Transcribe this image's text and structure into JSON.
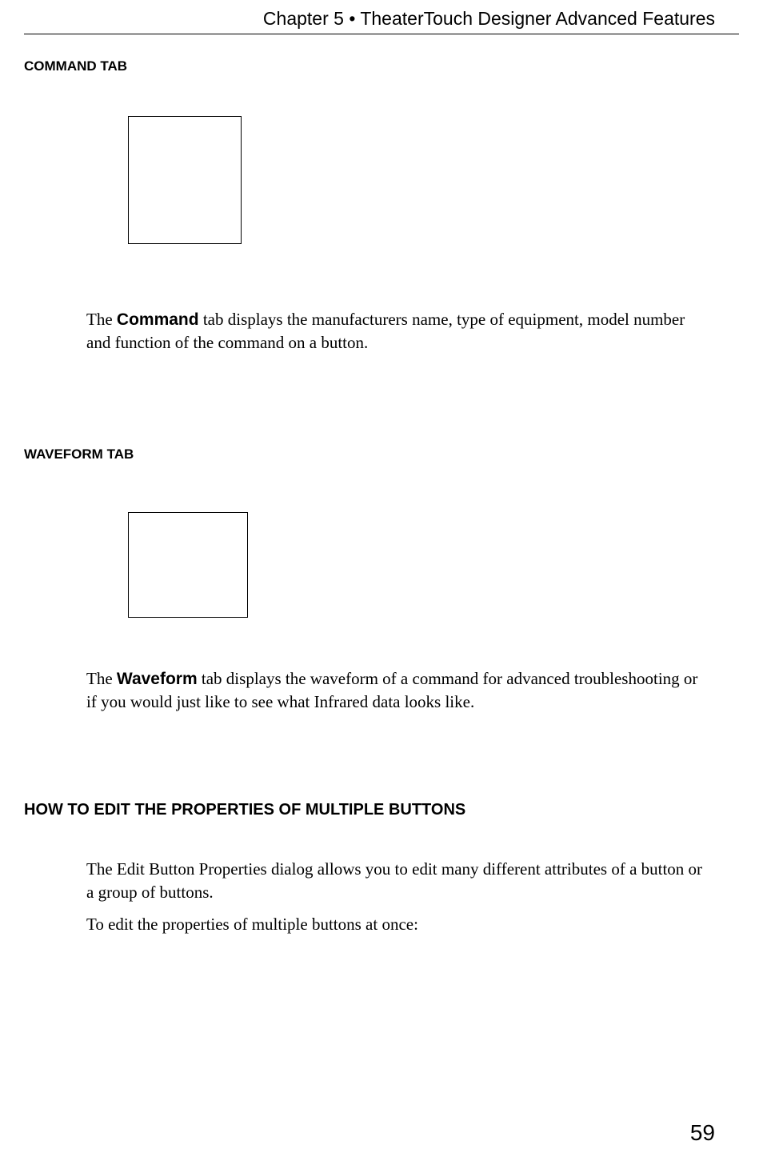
{
  "header": {
    "title": "Chapter 5 • TheaterTouch Designer Advanced Features"
  },
  "sections": {
    "command": {
      "heading": "COMMAND TAB",
      "para_prefix": "The ",
      "para_bold": "Command",
      "para_suffix": " tab displays the manufacturers name, type of equipment, model number and function of the command on a button."
    },
    "waveform": {
      "heading": "WAVEFORM TAB",
      "para_prefix": "The ",
      "para_bold": "Waveform",
      "para_suffix": " tab displays the waveform of a command for advanced troubleshooting or if you would just like to see what Infrared data looks like."
    },
    "multibuttons": {
      "heading": "HOW TO EDIT THE PROPERTIES OF MULTIPLE BUTTONS",
      "para1": "The Edit Button Properties dialog allows you to edit many different attributes of a button or a group of buttons.",
      "para2": "To edit the properties of multiple buttons at once:"
    }
  },
  "page_number": "59"
}
